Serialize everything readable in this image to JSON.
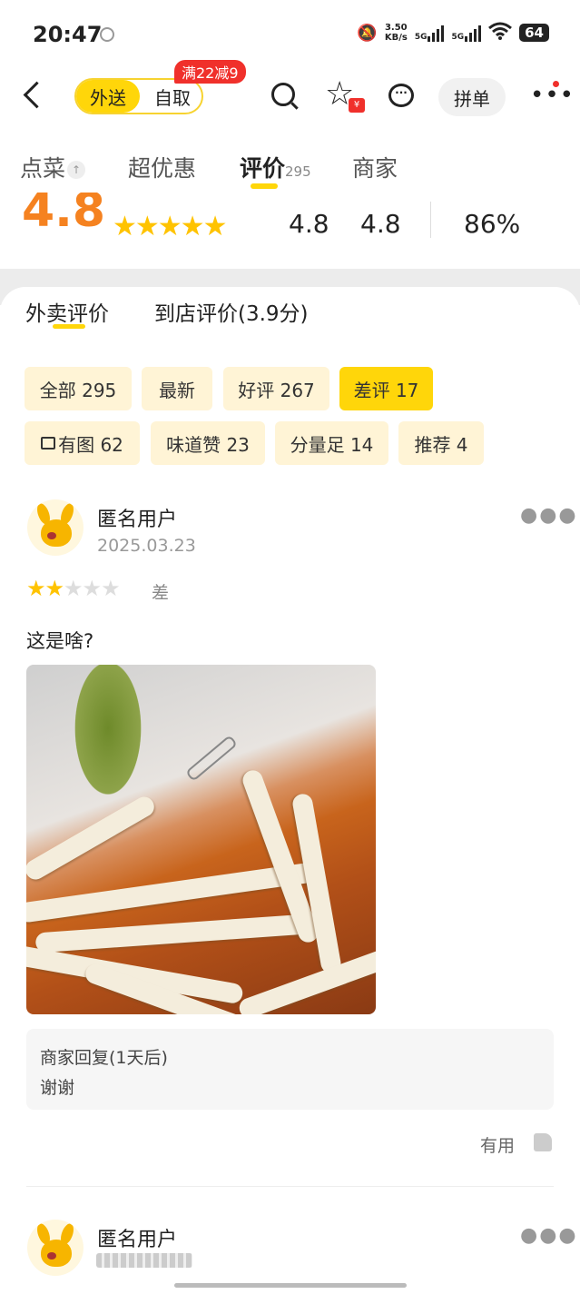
{
  "status_bar": {
    "time": "20:47",
    "net_speed_value": "3.50",
    "net_speed_unit": "KB/s",
    "sim1": "5G",
    "sim2": "5G",
    "battery": "64"
  },
  "top_nav": {
    "delivery_label": "外送",
    "pickup_label": "自取",
    "promo_badge": "满22减9",
    "star_badge": "¥",
    "pindan_label": "拼单"
  },
  "tabs": [
    {
      "label": "点菜"
    },
    {
      "label": "超优惠"
    },
    {
      "label": "评价",
      "count": "295"
    },
    {
      "label": "商家"
    }
  ],
  "rating": {
    "overall": "4.8",
    "stars": 5,
    "taste": "4.8",
    "packaging": "4.8",
    "satisfaction": "86%"
  },
  "sub_tabs": {
    "delivery_reviews": "外卖评价",
    "store_reviews": "到店评价(3.9分)"
  },
  "filters": [
    {
      "label": "全部 295"
    },
    {
      "label": "最新"
    },
    {
      "label": "好评 267"
    },
    {
      "label": "差评 17",
      "selected": true
    },
    {
      "label": "有图 62",
      "icon": "image-icon"
    },
    {
      "label": "味道赞 23"
    },
    {
      "label": "分量足 14"
    },
    {
      "label": "推荐 4"
    }
  ],
  "reviews": [
    {
      "user": "匿名用户",
      "date": "2025.03.23",
      "stars": 2,
      "rating_word": "差",
      "text": "这是啥?",
      "merchant_reply_title": "商家回复(1天后)",
      "merchant_reply_text": "谢谢",
      "useful_label": "有用"
    },
    {
      "user": "匿名用户"
    }
  ],
  "colors": {
    "accent_yellow": "#ffd60a",
    "chip_bg": "#fff4d6",
    "score_orange": "#f58220",
    "promo_red": "#f0302b",
    "star_gold": "#ffc300"
  }
}
